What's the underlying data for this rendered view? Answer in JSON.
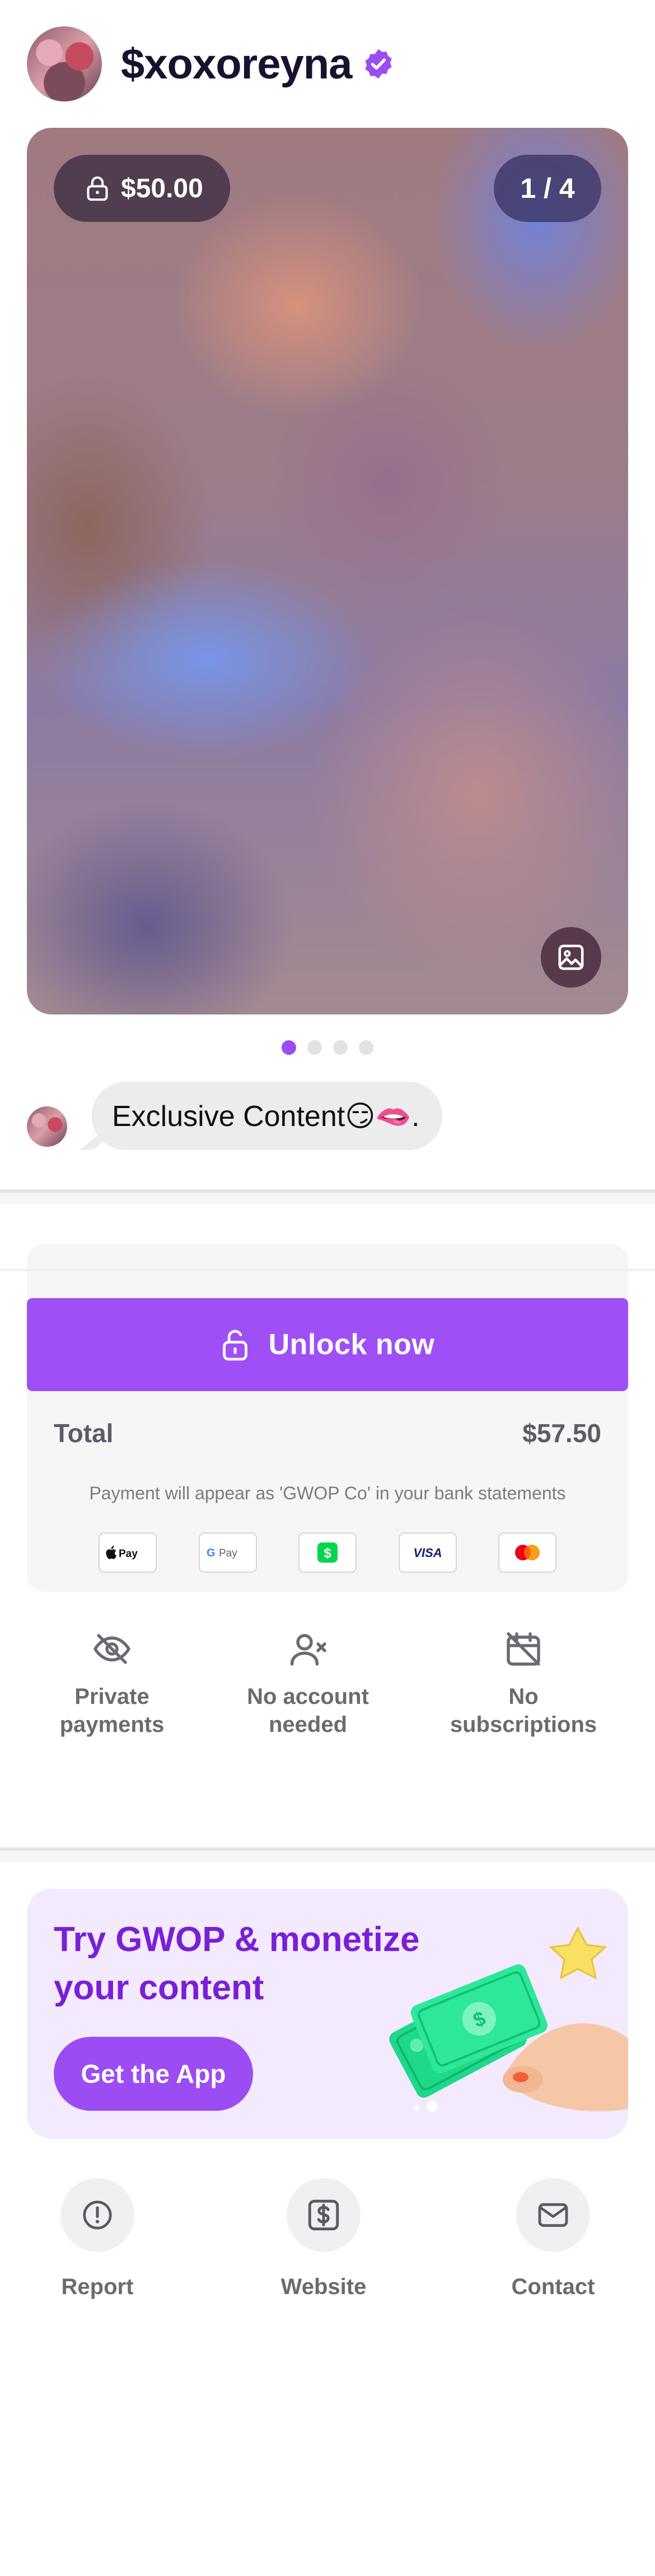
{
  "profile": {
    "username": "$xoxoreyna",
    "verified_icon": "verified-check-icon"
  },
  "media": {
    "price": "$50.00",
    "counter": "1 / 4",
    "slides_total": 4,
    "active_slide": 1
  },
  "message": {
    "text": "Exclusive Content😏🫦."
  },
  "checkout": {
    "unlock_label": "Unlock now",
    "total_label": "Total",
    "total_value": "$57.50",
    "statement_note": "Payment will appear as 'GWOP Co' in your bank statements",
    "payment_methods": [
      "Apple Pay",
      "Google Pay",
      "Cash App",
      "Visa",
      "Mastercard"
    ]
  },
  "features": {
    "private": "Private payments",
    "no_account": "No account needed",
    "no_subscriptions": "No subscriptions"
  },
  "promo": {
    "title": "Try GWOP & monetize your content",
    "cta": "Get the App"
  },
  "footer": {
    "report": "Report",
    "website": "Website",
    "contact": "Contact"
  },
  "colors": {
    "accent": "#9f4ff6",
    "promo_title": "#7a1fd8",
    "promo_bg": "#f3eafd"
  }
}
